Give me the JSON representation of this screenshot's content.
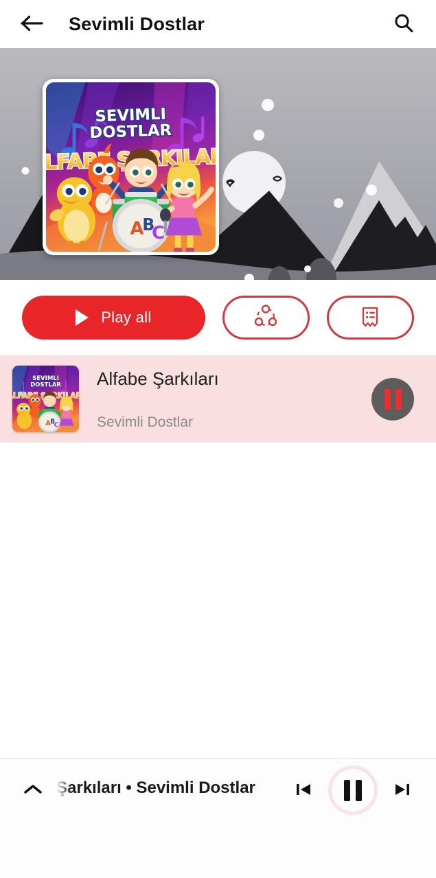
{
  "header": {
    "title": "Sevimli Dostlar",
    "back_icon": "arrow-left-icon",
    "search_icon": "search-icon"
  },
  "hero": {
    "cover": {
      "brand_line1": "SEVIMLI",
      "brand_line2": "DOSTLAR",
      "album_title": "ALFABE ŞARKILARI",
      "drum_letters": [
        "A",
        "B",
        "C"
      ]
    }
  },
  "actions": {
    "play_all_label": "Play all",
    "play_icon": "play-triangle-icon",
    "share_icon": "share-nodes-icon",
    "lyrics_icon": "lyrics-receipt-icon",
    "accent_color": "#e8262a",
    "outline_color": "#cf3a3c"
  },
  "list": {
    "rows": [
      {
        "title": "Alfabe Şarkıları",
        "artist": "Sevimli Dostlar",
        "state_icon": "pause-icon",
        "highlight_color": "#fadfe0",
        "action_bg": "#5d5d5d",
        "action_fg": "#ef2d31"
      }
    ]
  },
  "player": {
    "expand_icon": "chevron-up-icon",
    "now_playing": "Şarkıları • Sevimli Dostlar",
    "prev_icon": "skip-previous-icon",
    "play_pause_icon": "pause-icon",
    "next_icon": "skip-next-icon",
    "ring_color": "#fae3e4"
  }
}
